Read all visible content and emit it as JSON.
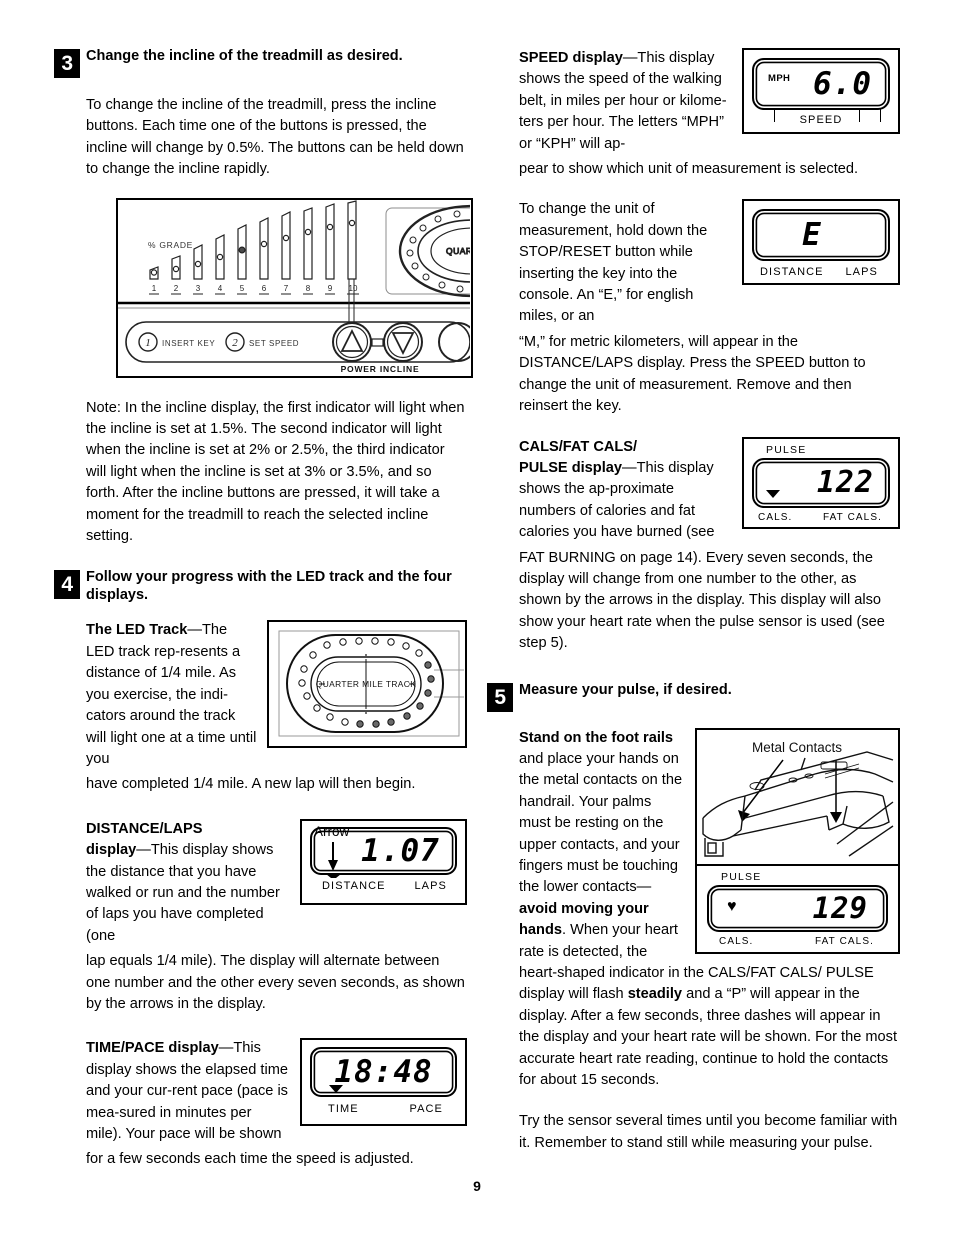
{
  "page": {
    "number": "9"
  },
  "left_column": {
    "step3": {
      "number": "3",
      "title": "Change the incline of the treadmill as desired.",
      "body": "To change the incline of the treadmill, press the incline buttons. Each time one of the buttons is pressed, the incline will change by 0.5%. The buttons can be held down to change the incline rapidly.",
      "note": "Note: In the incline display, the first indicator will light when the incline is set at 1.5%. The second indicator will light when the incline is set at 2% or 2.5%, the third indicator will light when the incline is set at 3% or 3.5%, and so forth. After the incline buttons are pressed, it will take a moment for the treadmill to reach the selected incline setting."
    },
    "console_figure": {
      "grade_label": "% GRADE",
      "grade_numbers": [
        "1",
        "2",
        "3",
        "4",
        "5",
        "6",
        "7",
        "8",
        "9",
        "10"
      ],
      "track_label": "QUART",
      "button_1_num": "1",
      "button_1_label": "INSERT KEY",
      "button_2_num": "2",
      "button_2_label": "SET SPEED",
      "power_incline_label": "POWER INCLINE"
    },
    "step4": {
      "number": "4",
      "title": "Follow your progress with the LED track and the four displays."
    },
    "led_track": {
      "heading": "The LED Track",
      "dash": "—",
      "text_wrap": "The LED track rep-resents a distance of 1/4 mile. As you exercise, the indi-cators around the track will light one at a time until you",
      "text_full": "have completed 1/4 mile. A new lap will then begin.",
      "figure_label": "QUARTER MILE TRACK"
    },
    "distance_laps": {
      "heading_line1": "DISTANCE/LAPS",
      "heading_line2": "display",
      "dash": "—",
      "text_wrap": "This display shows the distance that you have walked or run and the number of laps you have completed (one",
      "text_full": "lap equals 1/4 mile). The display will alternate between one number and the other every seven seconds, as shown by the arrows in the display.",
      "display": {
        "arrow_label": "Arrow",
        "value": "1.07",
        "label_left": "DISTANCE",
        "label_right": "LAPS"
      }
    },
    "time_pace": {
      "heading": "TIME/PACE display",
      "dash": "—",
      "text_wrap": "This display shows the elapsed time and your cur-rent pace (pace is mea-sured in minutes per mile). Your pace will be shown",
      "text_full": "for a few seconds each time the speed is adjusted.",
      "display": {
        "value": "18:48",
        "label_left": "TIME",
        "label_right": "PACE"
      }
    }
  },
  "right_column": {
    "speed": {
      "heading": "SPEED display",
      "dash": "—",
      "text_wrap": "This display shows the speed of the walking belt, in miles per hour or kilome-ters per hour. The letters “MPH” or “KPH” will ap-",
      "text_full": "pear to show which unit of measurement is selected.",
      "display": {
        "unit": "MPH",
        "value": "6.0",
        "label": "SPEED"
      }
    },
    "unit_change": {
      "text_wrap": "To change the unit of measurement, hold down the STOP/RESET button while inserting the key into the console. An “E,” for english miles, or an",
      "text_full": "“M,” for metric kilometers, will appear in the DISTANCE/LAPS display. Press the SPEED     button to change the unit of measurement. Remove and then reinsert the key.",
      "display": {
        "value": "E",
        "label_left": "DISTANCE",
        "label_right": "LAPS"
      }
    },
    "cals_fat_cals": {
      "heading_line1": "CALS/FAT CALS/",
      "heading_line2": "PULSE display",
      "dash": "—",
      "text_wrap": "This display shows the ap-proximate numbers of calories and fat calories you have burned (see",
      "text_full": "FAT BURNING on page 14). Every seven seconds, the display will change from one number to the other, as shown by the arrows in the display. This display will also show your heart rate when the pulse sensor is used (see step 5).",
      "display": {
        "top_label": "PULSE",
        "value": "122",
        "label_left": "CALS.",
        "label_right": "FAT CALS."
      }
    },
    "step5": {
      "number": "5",
      "title": "Measure your pulse, if desired.",
      "bold_lead": "Stand on the foot rails",
      "text_wrap_1": " and place your hands on the metal contacts on the handrail. Your palms must be resting on the upper contacts, and your fingers must be touching the lower contacts",
      "dash": "—",
      "bold_mid": "avoid moving your hands",
      "text_after_bold": ". When your heart rate is detected, the heart-shaped indicator in the CALS/FAT CALS/ PULSE display will flash ",
      "bold_steadily": "steadily",
      "text_end": " and a “P” will appear in the display. After a few seconds, three dashes will appear in the display and your heart rate will be shown. For the most accurate heart rate reading, continue to hold the contacts for about 15 seconds.",
      "closing": "Try the sensor several times until you become familiar with it. Remember to stand still while measuring your pulse."
    },
    "pulse_figure": {
      "callout": "Metal Contacts"
    },
    "pulse_display": {
      "top_label": "PULSE",
      "heart_icon": "♥",
      "value": "129",
      "label_left": "CALS.",
      "label_right": "FAT CALS."
    }
  },
  "colors": {
    "ink": "#000000",
    "paper": "#ffffff",
    "line_gray": "#7a7a7a"
  }
}
